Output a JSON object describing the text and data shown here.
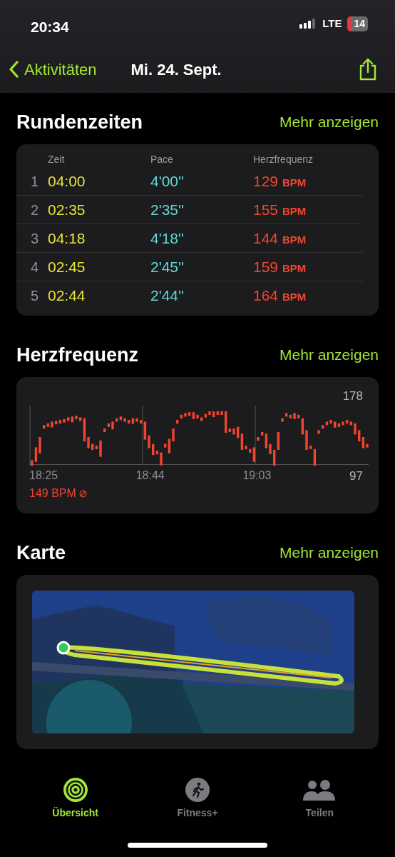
{
  "status_bar": {
    "time": "20:34",
    "network": "LTE",
    "battery": "14"
  },
  "nav": {
    "back": "Aktivitäten",
    "title": "Mi. 24. Sept."
  },
  "laps": {
    "title": "Rundenzeiten",
    "more": "Mehr anzeigen",
    "columns": [
      "Zeit",
      "Pace",
      "Herzfrequenz"
    ],
    "rows": [
      {
        "index": "1",
        "time": "04:00",
        "pace": "4'00''",
        "hr": "129",
        "unit": "BPM"
      },
      {
        "index": "2",
        "time": "02:35",
        "pace": "2'35''",
        "hr": "155",
        "unit": "BPM"
      },
      {
        "index": "3",
        "time": "04:18",
        "pace": "4'18''",
        "hr": "144",
        "unit": "BPM"
      },
      {
        "index": "4",
        "time": "02:45",
        "pace": "2'45''",
        "hr": "159",
        "unit": "BPM"
      },
      {
        "index": "5",
        "time": "02:44",
        "pace": "2'44''",
        "hr": "164",
        "unit": "BPM"
      }
    ]
  },
  "heart_rate": {
    "title": "Herzfrequenz",
    "more": "Mehr anzeigen",
    "max": "178",
    "min": "97",
    "times": [
      "18:25",
      "18:44",
      "19:03"
    ],
    "average": "149 BPM"
  },
  "map": {
    "title": "Karte",
    "more": "Mehr anzeigen",
    "kind": "picture"
  },
  "tab_bar": [
    {
      "label": "Übersicht",
      "selected": true,
      "kind": "rings"
    },
    {
      "label": "Fitness+",
      "selected": false,
      "kind": "runner"
    },
    {
      "label": "Teilen",
      "selected": false,
      "kind": "people"
    }
  ]
}
